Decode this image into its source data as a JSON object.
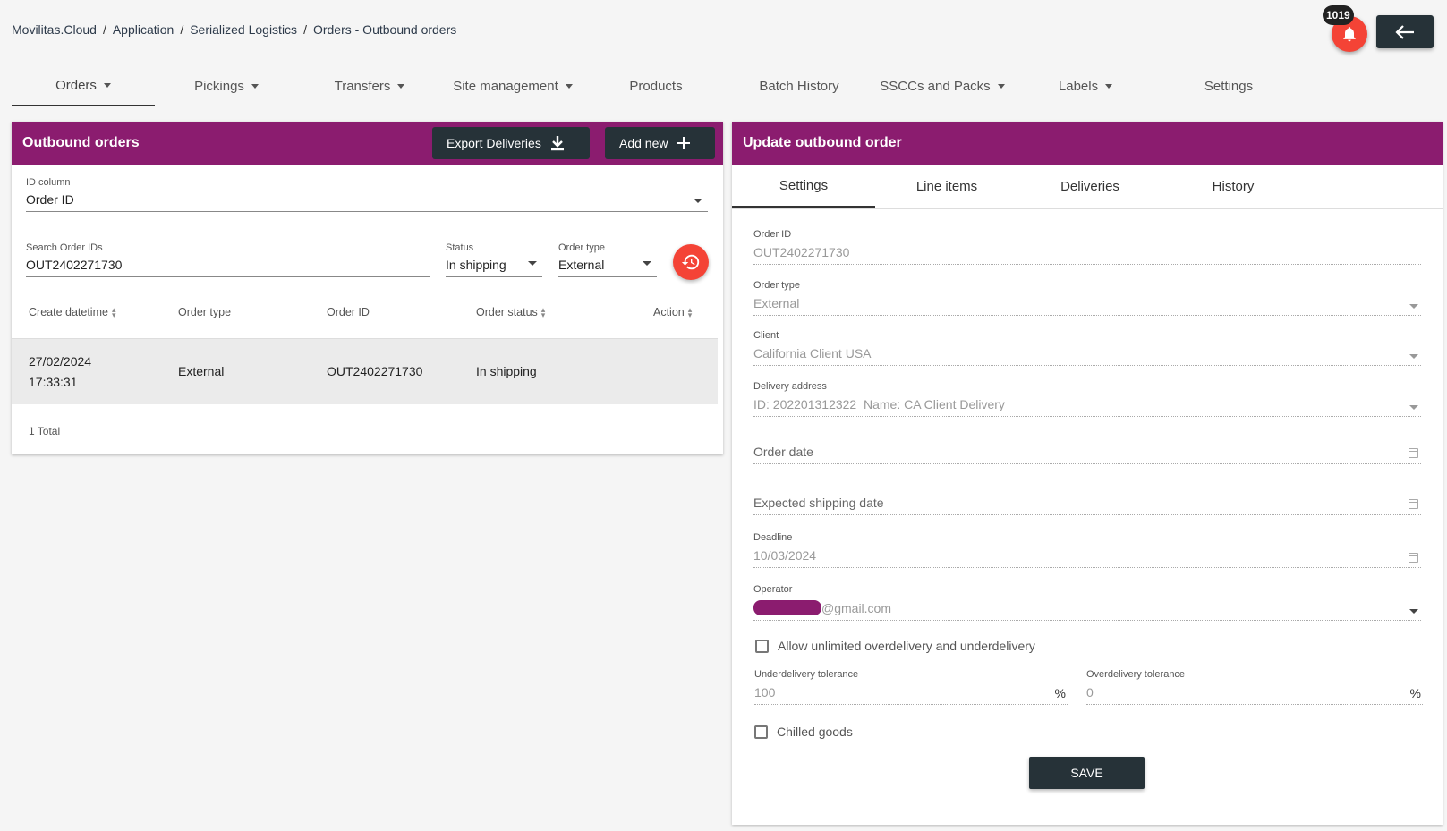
{
  "breadcrumb": [
    "Movilitas.Cloud",
    "Application",
    "Serialized Logistics",
    "Orders - Outbound orders"
  ],
  "notifications": {
    "count": "1019"
  },
  "nav": {
    "items": [
      {
        "label": "Orders",
        "dropdown": true
      },
      {
        "label": "Pickings",
        "dropdown": true
      },
      {
        "label": "Transfers",
        "dropdown": true
      },
      {
        "label": "Site management",
        "dropdown": true
      },
      {
        "label": "Products",
        "dropdown": false
      },
      {
        "label": "Batch History",
        "dropdown": false
      },
      {
        "label": "SSCCs and Packs",
        "dropdown": true
      },
      {
        "label": "Labels",
        "dropdown": true
      },
      {
        "label": "Settings",
        "dropdown": false
      }
    ]
  },
  "list_panel": {
    "title": "Outbound orders",
    "export_label": "Export Deliveries",
    "add_label": "Add new",
    "id_column": {
      "label": "ID column",
      "value": "Order ID"
    },
    "search": {
      "label": "Search Order IDs",
      "value": "OUT2402271730"
    },
    "status": {
      "label": "Status",
      "value": "In shipping"
    },
    "order_type": {
      "label": "Order type",
      "value": "External"
    },
    "columns": [
      "Create datetime",
      "Order type",
      "Order ID",
      "Order status",
      "Action"
    ],
    "rows": [
      {
        "date": "27/02/2024",
        "time": "17:33:31",
        "order_type": "External",
        "order_id": "OUT2402271730",
        "status": "In shipping"
      }
    ],
    "total": "1 Total"
  },
  "detail_panel": {
    "title": "Update outbound order",
    "tabs": [
      "Settings",
      "Line items",
      "Deliveries",
      "History"
    ],
    "order_id": {
      "label": "Order ID",
      "value": "OUT2402271730"
    },
    "order_type": {
      "label": "Order type",
      "value": "External"
    },
    "client": {
      "label": "Client",
      "value": "California Client USA"
    },
    "delivery_address": {
      "label": "Delivery address",
      "value": "ID: 202201312322  Name: CA Client Delivery"
    },
    "order_date": {
      "placeholder": "Order date"
    },
    "expected_shipping": {
      "placeholder": "Expected shipping date"
    },
    "deadline": {
      "label": "Deadline",
      "value": "10/03/2024"
    },
    "operator": {
      "label": "Operator",
      "value": "@gmail.com"
    },
    "allow_unlimited": "Allow unlimited overdelivery and underdelivery",
    "underdelivery": {
      "label": "Underdelivery tolerance",
      "value": "100",
      "unit": "%"
    },
    "overdelivery": {
      "label": "Overdelivery tolerance",
      "value": "0",
      "unit": "%"
    },
    "chilled": "Chilled goods",
    "save_label": "SAVE"
  },
  "colors": {
    "header": "#8b1c6f",
    "button_dark": "#263238",
    "accent_red": "#f44336"
  }
}
